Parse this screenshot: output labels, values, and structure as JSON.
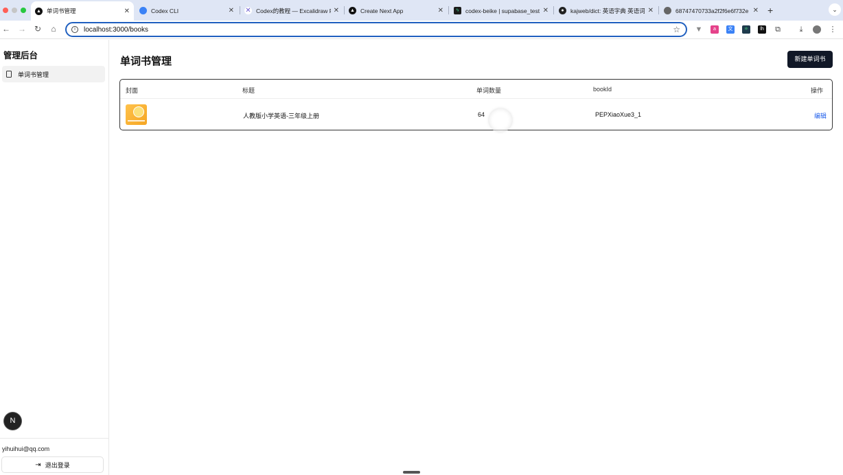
{
  "browser": {
    "tabs": [
      {
        "title": "单词书管理",
        "active": true
      },
      {
        "title": "Codex CLI",
        "active": false
      },
      {
        "title": "Codex的教程 — Excalidraw Plus",
        "active": false
      },
      {
        "title": "Create Next App",
        "active": false
      },
      {
        "title": "codex-beike | supabase_test",
        "active": false
      },
      {
        "title": "kajweb/dict: 英语字典 英语词库",
        "active": false
      },
      {
        "title": "68747470733a2f2f6e6f732e",
        "active": false
      }
    ],
    "url": "localhost:3000/books",
    "new_tab": "+",
    "tab_menu": "⌄"
  },
  "sidebar": {
    "brand": "管理后台",
    "items": [
      {
        "label": "单词书管理",
        "icon": "book-icon"
      }
    ],
    "email": "yihuihui@qq.com",
    "logout_label": "退出登录",
    "badge": "N"
  },
  "main": {
    "title": "单词书管理",
    "new_button": "新建单词书",
    "columns": [
      "封面",
      "标题",
      "单词数量",
      "bookId",
      "操作"
    ],
    "rows": [
      {
        "title": "人教版小学英语-三年级上册",
        "word_count": "64",
        "book_id": "PEPXiaoXue3_1",
        "action": "编辑"
      }
    ]
  },
  "colors": {
    "accent": "#1f5fbf",
    "primary_button": "#111827",
    "link": "#2563eb"
  }
}
